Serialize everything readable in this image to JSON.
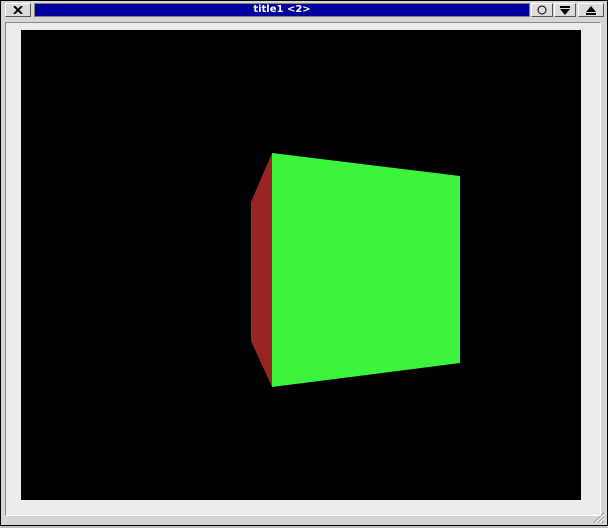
{
  "window": {
    "title": "title1 <2>"
  },
  "titlebar": {
    "buttons": [
      {
        "name": "close",
        "icon": "close-x-icon"
      },
      {
        "name": "iconify",
        "icon": "circle-icon"
      },
      {
        "name": "shade",
        "icon": "shade-down-icon"
      },
      {
        "name": "maximize",
        "icon": "maximize-up-icon"
      }
    ]
  },
  "scene": {
    "background": "#000000",
    "cube_faces": [
      {
        "name": "front-face",
        "color": "#3cf43c"
      },
      {
        "name": "left-face",
        "color": "#982424"
      }
    ]
  },
  "colors": {
    "title_active": "#00009c",
    "frame": "#d6d6d6"
  }
}
